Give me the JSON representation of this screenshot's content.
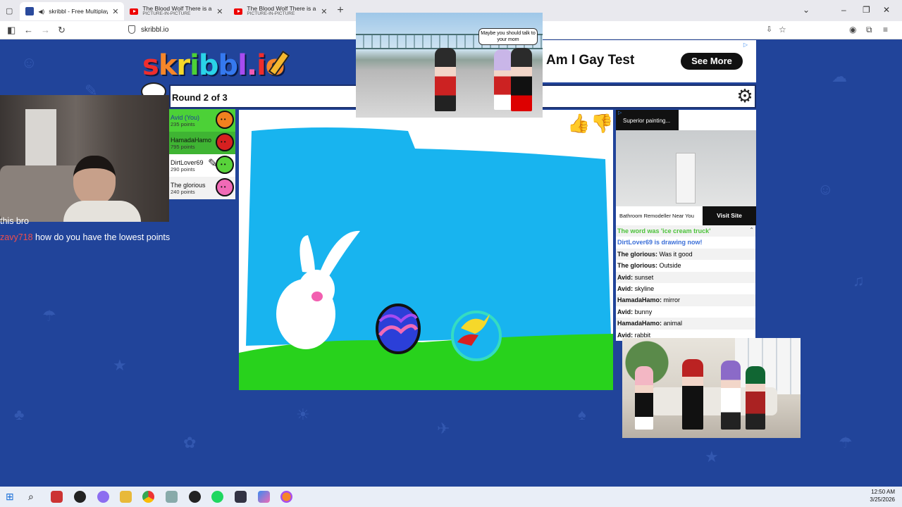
{
  "browser": {
    "tabs": [
      {
        "title": "skribbl - Free Multiplayer D",
        "subtitle": "",
        "active": true
      },
      {
        "title": "The Blood Wolf There is a few s",
        "subtitle": "PICTURE-IN-PICTURE",
        "active": false
      },
      {
        "title": "The Blood Wolf There is a few s",
        "subtitle": "PICTURE-IN-PICTURE",
        "active": false
      }
    ],
    "url": "skribbl.io"
  },
  "game": {
    "logo_text": "skribbl.io",
    "round_label": "Round 2 of 3",
    "players": [
      {
        "name": "Avid (You)",
        "points": "235 points",
        "highlight": "#4cd137",
        "avatar_color": "#f0811f"
      },
      {
        "name": "HamadaHamo",
        "points": "795 points",
        "highlight": "#3fb433",
        "avatar_color": "#d62020"
      },
      {
        "name": "DirtLover69",
        "points": "290 points",
        "highlight": "#ffffff",
        "avatar_color": "#58d33a"
      },
      {
        "name": "The glorious",
        "points": "240 points",
        "highlight": "#ffffff",
        "avatar_color": "#f06ab6"
      }
    ],
    "chat": [
      {
        "kind": "system-green",
        "text": "The word was 'ice cream truck'"
      },
      {
        "kind": "system-blue",
        "text": "DirtLover69 is drawing now!"
      },
      {
        "kind": "msg",
        "user": "The glorious:",
        "text": " Was it good"
      },
      {
        "kind": "msg",
        "user": "The glorious:",
        "text": " Outside"
      },
      {
        "kind": "msg",
        "user": "Avid:",
        "text": " sunset"
      },
      {
        "kind": "msg",
        "user": "Avid:",
        "text": " skyline"
      },
      {
        "kind": "msg",
        "user": "HamadaHamo:",
        "text": " mirror"
      },
      {
        "kind": "msg",
        "user": "Avid:",
        "text": " bunny"
      },
      {
        "kind": "msg",
        "user": "HamadaHamo:",
        "text": " animal"
      },
      {
        "kind": "msg",
        "user": "Avid:",
        "text": " rabbit"
      }
    ]
  },
  "ads": {
    "top_text": "Am I Gay Test",
    "top_button": "See More",
    "side_title": "Superior painting...",
    "side_text": "Bathroom Remodeller Near You",
    "side_button": "Visit Site"
  },
  "pip_top": {
    "bubble": "Maybe you should talk to your mom"
  },
  "stream_chat": {
    "line1_user": "",
    "line1_text": "this bro",
    "line2_user": "zavy718",
    "line2_text": "how do you have the lowest points"
  },
  "taskbar": {
    "time": "12:50 AM",
    "date": "3/25/2026"
  },
  "colors": {
    "page_bg": "#21449a",
    "sky": "#18b4ef",
    "grass": "#28d21c"
  }
}
